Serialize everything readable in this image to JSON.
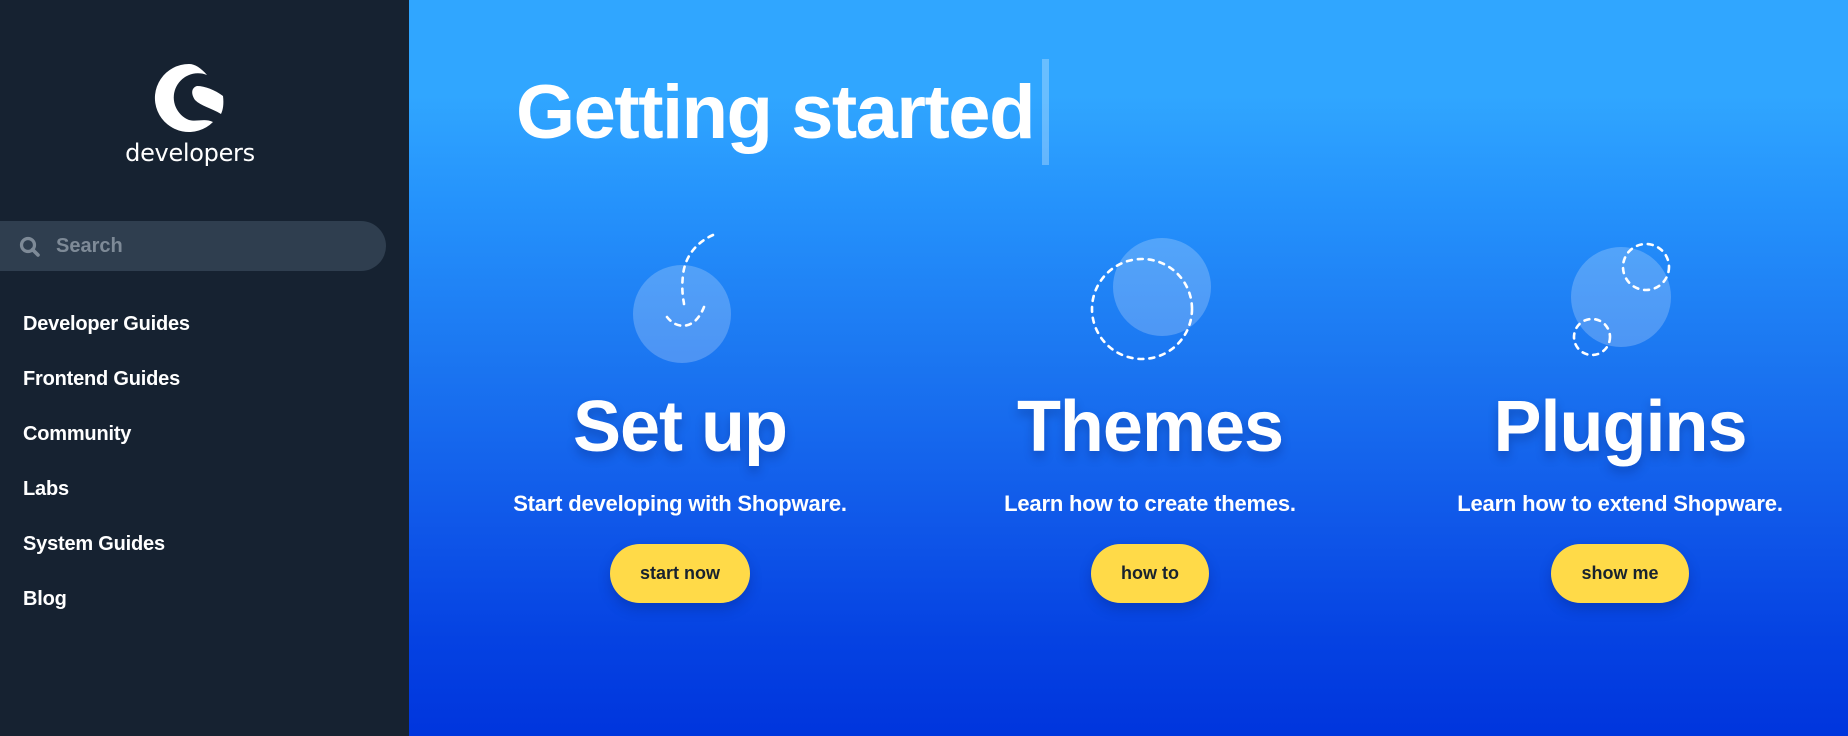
{
  "sidebar": {
    "logo_text": "developers",
    "search": {
      "placeholder": "Search",
      "value": ""
    },
    "nav": [
      {
        "label": "Developer Guides"
      },
      {
        "label": "Frontend Guides"
      },
      {
        "label": "Community"
      },
      {
        "label": "Labs"
      },
      {
        "label": "System Guides"
      },
      {
        "label": "Blog"
      }
    ]
  },
  "main": {
    "title": "Getting started",
    "cards": [
      {
        "title": "Set up",
        "subtitle": "Start developing with Shopware.",
        "button": "start now",
        "icon": "setup-illustration"
      },
      {
        "title": "Themes",
        "subtitle": "Learn how to create themes.",
        "button": "how to",
        "icon": "themes-illustration"
      },
      {
        "title": "Plugins",
        "subtitle": "Learn how to extend Shopware.",
        "button": "show me",
        "icon": "plugins-illustration"
      }
    ]
  },
  "colors": {
    "sidebar_bg": "#162231",
    "search_bg": "#2f3e4f",
    "gradient_top": "#30a6ff",
    "gradient_bottom": "#0035dd",
    "button_bg": "#ffda48",
    "button_text": "#18222e"
  }
}
